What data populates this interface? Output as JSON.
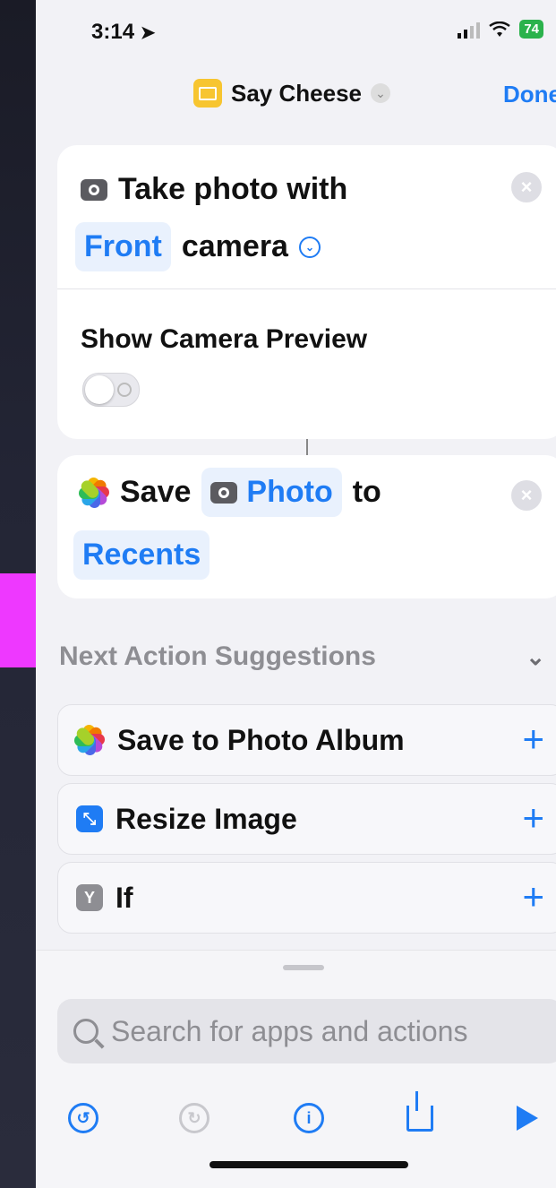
{
  "status_bar": {
    "time": "3:14",
    "battery": "74"
  },
  "header": {
    "title": "Say Cheese",
    "done_label": "Done"
  },
  "action1": {
    "text": "Take photo with",
    "camera_value": "Front",
    "camera_suffix": "camera",
    "param_label": "Show Camera Preview",
    "toggle_on": false
  },
  "action2": {
    "verb": "Save",
    "input": "Photo",
    "to": "to",
    "destination": "Recents"
  },
  "suggestions": {
    "title": "Next Action Suggestions",
    "items": [
      {
        "label": "Save to Photo Album",
        "icon": "photos-icon"
      },
      {
        "label": "Resize Image",
        "icon": "resize-image-icon",
        "color": "#1f7cf4"
      },
      {
        "label": "If",
        "icon": "if-branch-icon",
        "color": "#8e8e93"
      }
    ]
  },
  "search": {
    "placeholder": "Search for apps and actions"
  },
  "colors": {
    "accent": "#1f7cf4",
    "highlight": "#ee38ff"
  }
}
